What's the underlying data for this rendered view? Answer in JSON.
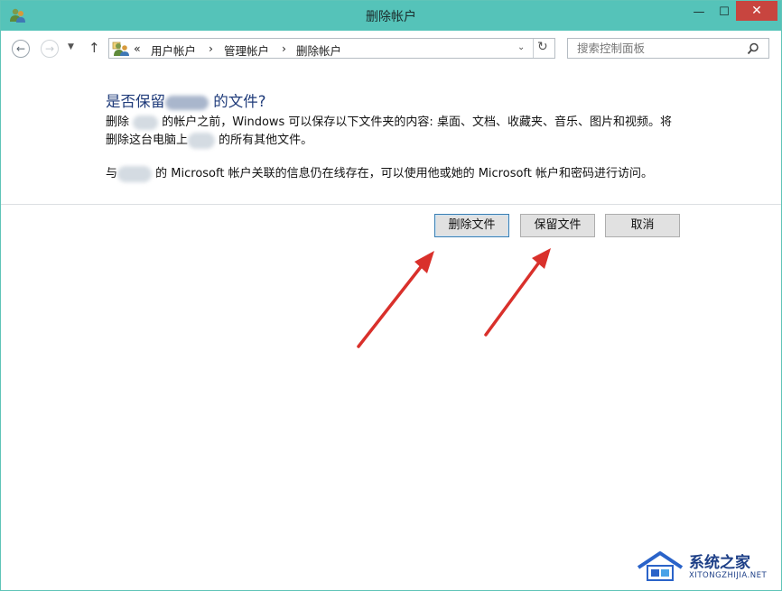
{
  "window": {
    "title": "删除帐户",
    "controls": {
      "minimize": "—",
      "maximize": "☐",
      "close": "✕"
    }
  },
  "nav": {
    "back_icon": "←",
    "forward_icon": "→",
    "recent_icon": "▼",
    "up_icon": "↑",
    "address": {
      "overflow": "«",
      "separator": "›",
      "crumbs": [
        "用户帐户",
        "管理帐户",
        "删除帐户"
      ],
      "dropdown_icon": "⌄",
      "refresh_icon": "↻"
    },
    "search": {
      "placeholder": "搜索控制面板"
    }
  },
  "content": {
    "heading_prefix": "是否保留",
    "heading_suffix": " 的文件?",
    "para1_a": "删除 ",
    "para1_b": " 的帐户之前，Windows 可以保存以下文件夹的内容: 桌面、文档、收藏夹、音乐、图片和视频。将",
    "para2_a": "删除这台电脑上",
    "para2_b": " 的所有其他文件。",
    "para3_a": "与",
    "para3_b": " 的 Microsoft 帐户关联的信息仍在线存在，可以使用他或她的 Microsoft 帐户和密码进行访问。"
  },
  "buttons": {
    "delete_files": "删除文件",
    "keep_files": "保留文件",
    "cancel": "取消"
  },
  "watermark": {
    "name": "系统之家",
    "url": "XITONGZHIJIA.NET"
  },
  "colors": {
    "titlebar": "#55c3b9",
    "close": "#c8453f",
    "heading": "#1f3b7a",
    "arrow": "#d9302b",
    "watermark": "#1d3f87"
  }
}
